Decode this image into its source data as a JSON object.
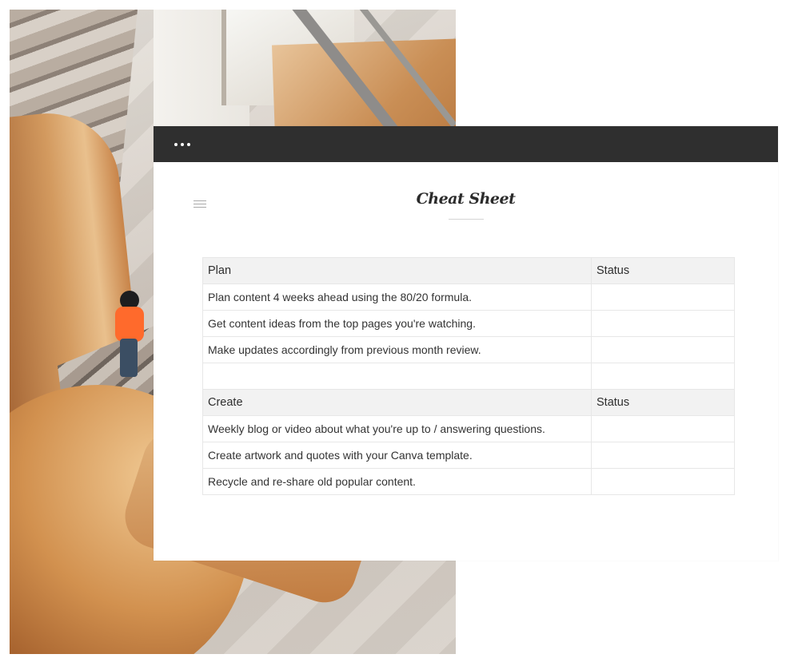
{
  "window": {
    "menu_icon": "ellipsis-icon",
    "sidebar_icon": "hamburger-icon",
    "title": "Cheat Sheet"
  },
  "background": {
    "image": "spiral wooden staircase with person in orange top, viewed from above"
  },
  "table": {
    "sections": [
      {
        "header": {
          "task": "Plan",
          "status": "Status"
        },
        "rows": [
          {
            "task": "Plan content 4 weeks ahead using the 80/20 formula.",
            "status": ""
          },
          {
            "task": "Get content ideas from the top pages you're watching.",
            "status": ""
          },
          {
            "task": "Make updates accordingly from previous month review.",
            "status": ""
          },
          {
            "task": "",
            "status": ""
          }
        ]
      },
      {
        "header": {
          "task": "Create",
          "status": "Status"
        },
        "rows": [
          {
            "task": "Weekly blog or video about what you're up to / answering questions.",
            "status": ""
          },
          {
            "task": "Create artwork and quotes with your Canva template.",
            "status": ""
          },
          {
            "task": "Recycle and re-share old popular content.",
            "status": ""
          }
        ]
      }
    ]
  },
  "colors": {
    "titlebar": "#2f2f2f",
    "header_row": "#f2f2f2",
    "border": "#e7e7e7"
  }
}
